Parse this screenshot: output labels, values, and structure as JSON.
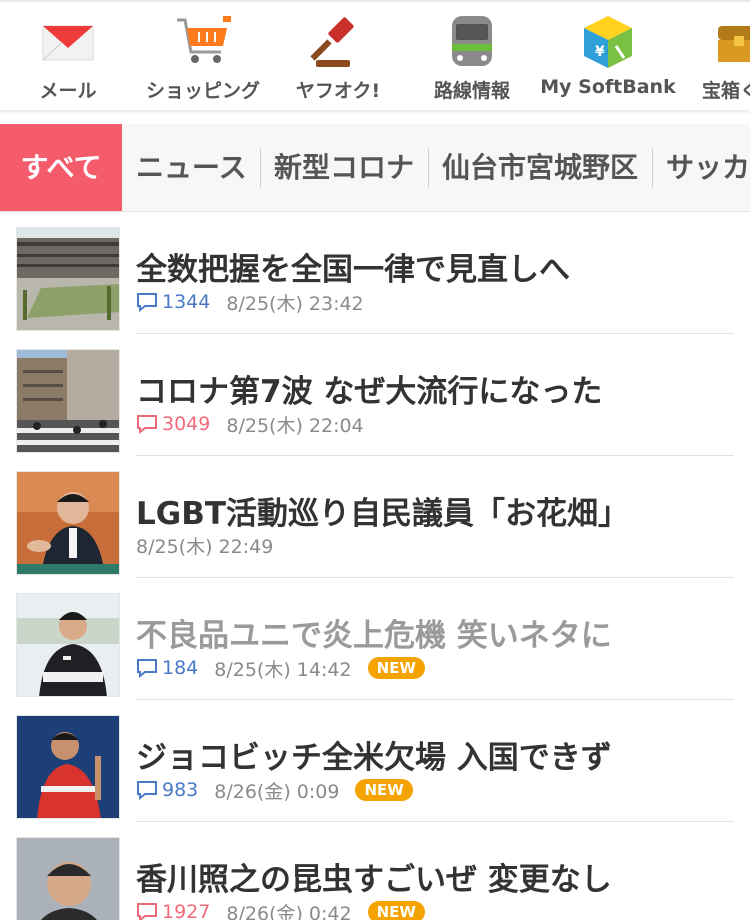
{
  "services": [
    {
      "label": "メール",
      "icon": "mail-icon"
    },
    {
      "label": "ショッピング",
      "icon": "shopping-cart-icon"
    },
    {
      "label": "ヤフオク!",
      "icon": "auction-gavel-icon"
    },
    {
      "label": "路線情報",
      "icon": "train-icon"
    },
    {
      "label": "My SoftBank",
      "icon": "softbank-cube-icon"
    },
    {
      "label": "宝箱く",
      "icon": "treasure-chest-icon"
    }
  ],
  "tabs": [
    {
      "label": "すべて",
      "active": true
    },
    {
      "label": "ニュース",
      "active": false
    },
    {
      "label": "新型コロナ",
      "active": false
    },
    {
      "label": "仙台市宮城野区",
      "active": false
    },
    {
      "label": "サッカ",
      "active": false
    }
  ],
  "news": [
    {
      "title": "全数把握を全国一律で見直しへ",
      "comments": "1344",
      "comment_color": "blue",
      "date": "8/25(木) 23:42",
      "is_new": false,
      "read": false,
      "thumb_icon": "building-photo"
    },
    {
      "title": "コロナ第7波 なぜ大流行になった",
      "comments": "3049",
      "comment_color": "red",
      "date": "8/25(木) 22:04",
      "is_new": false,
      "read": false,
      "thumb_icon": "crosswalk-photo"
    },
    {
      "title": "LGBT活動巡り自民議員「お花畑」",
      "comments": "",
      "comment_color": "",
      "date": "8/25(木) 22:49",
      "is_new": false,
      "read": false,
      "thumb_icon": "politician-photo"
    },
    {
      "title": "不良品ユニで炎上危機 笑いネタに",
      "comments": "184",
      "comment_color": "blue",
      "date": "8/25(木) 14:42",
      "is_new": true,
      "read": true,
      "thumb_icon": "footballer-photo"
    },
    {
      "title": "ジョコビッチ全米欠場 入国できず",
      "comments": "983",
      "comment_color": "blue",
      "date": "8/26(金) 0:09",
      "is_new": true,
      "read": false,
      "thumb_icon": "tennis-player-photo"
    },
    {
      "title": "香川照之の昆虫すごいぜ 変更なし",
      "comments": "1927",
      "comment_color": "red",
      "date": "8/26(金) 0:42",
      "is_new": true,
      "read": false,
      "thumb_icon": "actor-photo"
    }
  ],
  "new_badge_label": "NEW",
  "colors": {
    "accent": "#f45b6b",
    "link_blue": "#4a79c7",
    "comment_red": "#f06b7a",
    "badge": "#f5a300"
  }
}
